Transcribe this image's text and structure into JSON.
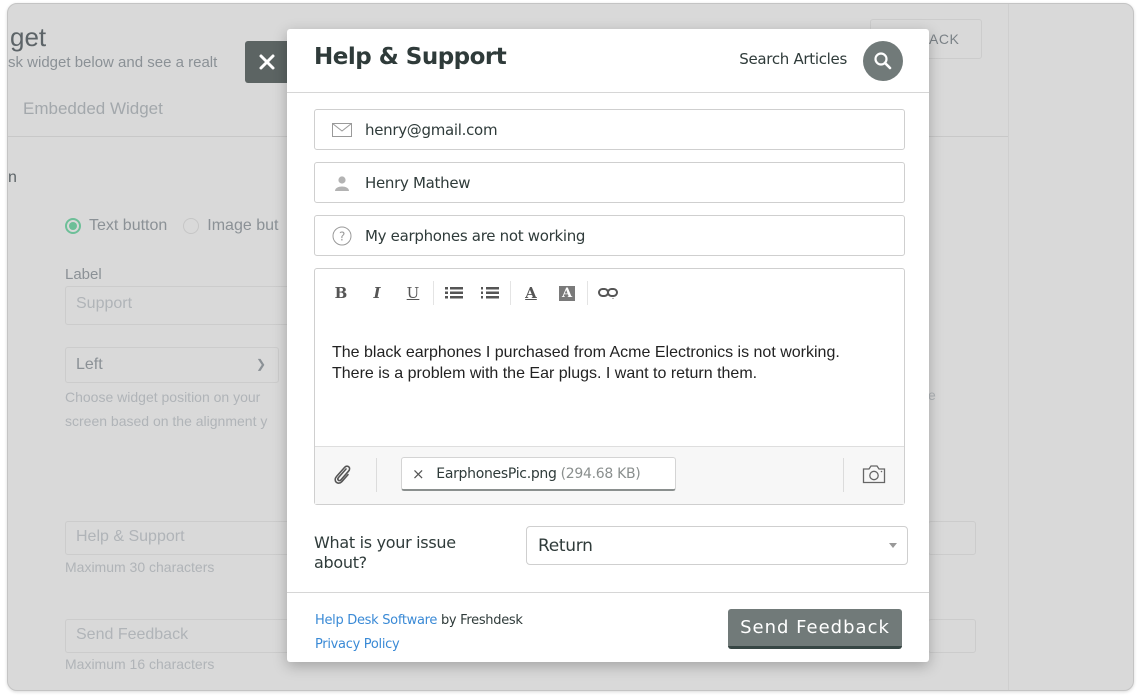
{
  "background": {
    "title_fragment": "get",
    "subtitle_fragment": "sk widget below and see a realt",
    "tab": "Embedded Widget",
    "section_fragment": "n",
    "feedback_button_fragment": "ACK",
    "radio_options": [
      {
        "label": "Text button",
        "checked": true
      },
      {
        "label": "Image but",
        "checked": false
      }
    ],
    "label_caption": "Label",
    "label_value": "Support",
    "position_select": "Left",
    "position_help_1": "Choose widget position on your",
    "position_help_2": "screen based on the alignment y",
    "right_fragment": "e",
    "title_input": "Help & Support",
    "title_help": "Maximum 30 characters",
    "button_input": "Send Feedback",
    "button_help": "Maximum 16 characters"
  },
  "modal": {
    "title": "Help & Support",
    "search_label": "Search Articles",
    "fields": {
      "email": "henry@gmail.com",
      "name": "Henry Mathew",
      "subject": "My earphones are not working"
    },
    "toolbar": [
      "bold",
      "italic",
      "underline",
      "bulleted-list",
      "numbered-list",
      "font-color",
      "background-color",
      "link"
    ],
    "toolbar_glyphs": {
      "bold": "B",
      "italic": "I",
      "underline": "U",
      "font_color": "A",
      "background_color": "A"
    },
    "description_line1": "The black earphones I purchased from Acme Electronics is not working.",
    "description_line2": "There is a problem with the Ear plugs. I want to return them.",
    "attachment": {
      "remove": "×",
      "filename": "EarphonesPic.png",
      "size": "(294.68 KB)"
    },
    "issue_label": "What is your issue about?",
    "issue_value": "Return",
    "footer": {
      "helpdesk_link": "Help Desk Software",
      "by_text": "by Freshdesk",
      "privacy_link": "Privacy Policy",
      "send_button": "Send Feedback"
    }
  },
  "colors": {
    "primary_button": "#717a79",
    "link": "#3a8ad6",
    "radio_checked": "#6dbf98",
    "overlay": "#d9d9d9"
  }
}
